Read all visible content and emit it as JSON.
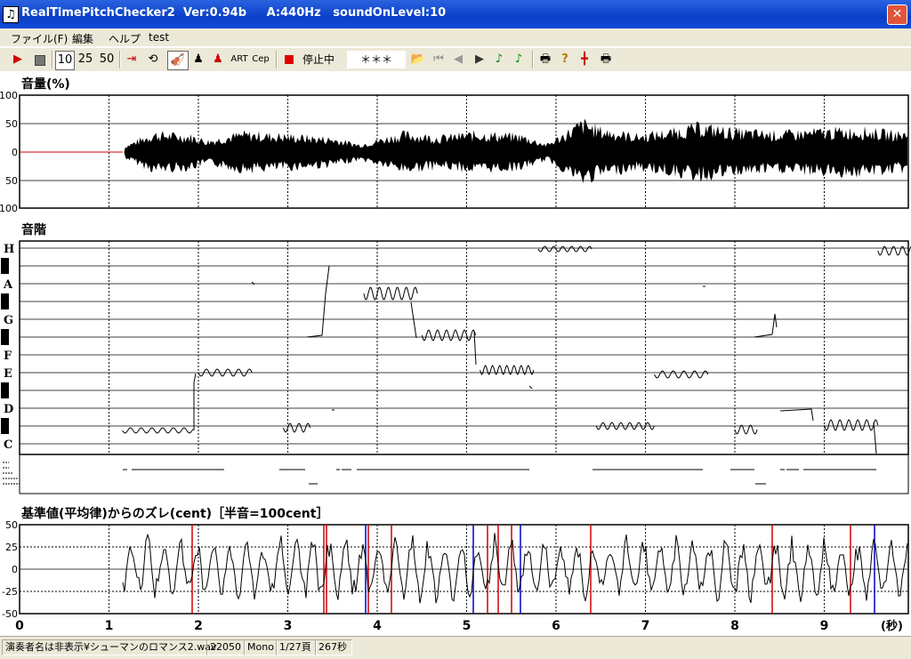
{
  "window": {
    "title": "RealTimePitchChecker2  Ver:0.94b     A:440Hz   soundOnLevel:10",
    "close_glyph": "✕"
  },
  "menu": [
    "ファイル(F)",
    "編集",
    "ヘルプ",
    "test"
  ],
  "toolbar": {
    "t10": "10",
    "t25": "25",
    "t50": "50",
    "art": "ART",
    "cep": "Cep",
    "status": "停止中",
    "note": "＊＊＊"
  },
  "volume": {
    "title": "音量(%)",
    "ticks": [
      "100",
      "50",
      "0",
      "50",
      "100"
    ]
  },
  "scale": {
    "title": "音階",
    "notes": [
      "H",
      "A",
      "G",
      "F",
      "E",
      "D",
      "C"
    ]
  },
  "deviation": {
    "title": "基準値(平均律)からのズレ(cent)［半音=100cent］",
    "ticks": [
      "50",
      "25",
      "0",
      "-25",
      "-50"
    ]
  },
  "time_axis": {
    "labels": [
      "0",
      "1",
      "2",
      "3",
      "4",
      "5",
      "6",
      "7",
      "8",
      "9"
    ],
    "unit": "(秒)"
  },
  "status": {
    "file": "演奏者名は非表示¥シューマンのロマンス2.wav",
    "rate": "22050",
    "channels": "Mono",
    "page": "1/27頁",
    "duration": "267秒"
  },
  "colors": {
    "title_bar": "#0a3fc7",
    "panel_bg": "#ece9d8",
    "red_marker": "#d00000",
    "blue_marker": "#0000c8"
  }
}
